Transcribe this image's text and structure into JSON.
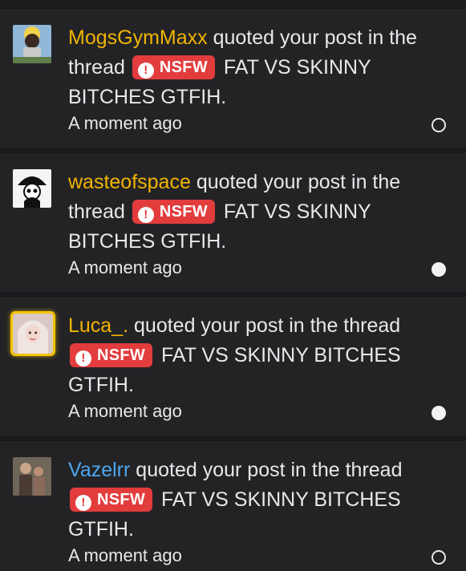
{
  "alerts": [
    {
      "user": "MogsGymMaxx",
      "user_color": "#f0b400",
      "action": "quoted your post in the thread",
      "prefix": "NSFW",
      "prefix_icon": "exclamation-icon",
      "thread": "FAT VS SKINNY BITCHES GTFIH.",
      "time": "A moment ago",
      "status": "read"
    },
    {
      "user": "wasteofspace",
      "user_color": "#f0b400",
      "action": "quoted your post in the thread",
      "prefix": "NSFW",
      "prefix_icon": "exclamation-icon",
      "thread": "FAT VS SKINNY BITCHES GTFIH.",
      "time": "A moment ago",
      "status": "unread"
    },
    {
      "user": "Luca_.",
      "user_color": "#f0b400",
      "action": "quoted your post in the thread",
      "prefix": "NSFW",
      "prefix_icon": "exclamation-icon",
      "thread": "FAT VS SKINNY BITCHES GTFIH.",
      "time": "A moment ago",
      "status": "unread"
    },
    {
      "user": "Vazelrr",
      "user_color": "#4ea5ee",
      "action": "quoted your post in the thread",
      "prefix": "NSFW",
      "prefix_icon": "exclamation-icon",
      "thread": "FAT VS SKINNY BITCHES GTFIH.",
      "time": "A moment ago",
      "status": "read"
    }
  ],
  "colors": {
    "background": "#1c1c1e",
    "row_background": "#232326",
    "text": "#e8e8ea",
    "nsfw_badge": "#e23c3c",
    "highlight_border": "#f5c400"
  }
}
